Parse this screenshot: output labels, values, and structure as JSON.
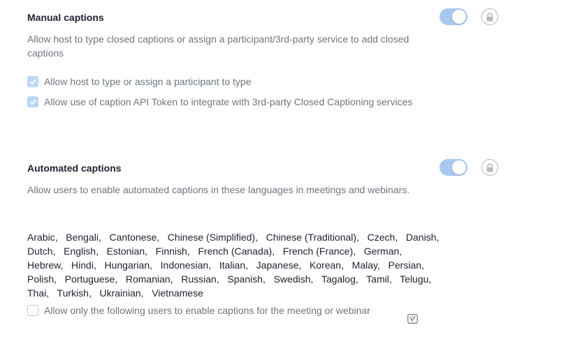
{
  "manual": {
    "title": "Manual captions",
    "description": "Allow host to type closed captions or assign a participant/3rd-party service to add closed captions",
    "toggle_on": true,
    "locked": false,
    "options": [
      {
        "label": "Allow host to type or assign a participant to type",
        "checked": true
      },
      {
        "label": "Allow use of caption API Token to integrate with 3rd-party Closed Captioning services",
        "checked": true
      }
    ]
  },
  "automated": {
    "title": "Automated captions",
    "description": "Allow users to enable automated captions in these languages in meetings and webinars.",
    "toggle_on": true,
    "locked": false,
    "languages": [
      "Arabic",
      "Bengali",
      "Cantonese",
      "Chinese (Simplified)",
      "Chinese (Traditional)",
      "Czech",
      "Danish",
      "Dutch",
      "English",
      "Estonian",
      "Finnish",
      "French (Canada)",
      "French (France)",
      "German",
      "Hebrew",
      "Hindi",
      "Hungarian",
      "Indonesian",
      "Italian",
      "Japanese",
      "Korean",
      "Malay",
      "Persian",
      "Polish",
      "Portuguese",
      "Romanian",
      "Russian",
      "Spanish",
      "Swedish",
      "Tagalog",
      "Tamil",
      "Telugu",
      "Thai",
      "Turkish",
      "Ukrainian",
      "Vietnamese"
    ],
    "restrict_option": {
      "label": "Allow only the following users to enable captions for the meeting or webinar",
      "checked": false
    }
  },
  "colors": {
    "toggle_on": "#a9c8f0",
    "checkbox_checked": "#bcd6f6",
    "muted_text": "#6e7680"
  },
  "icons": {
    "lock": "lock-icon",
    "info": "edit-info-icon"
  }
}
